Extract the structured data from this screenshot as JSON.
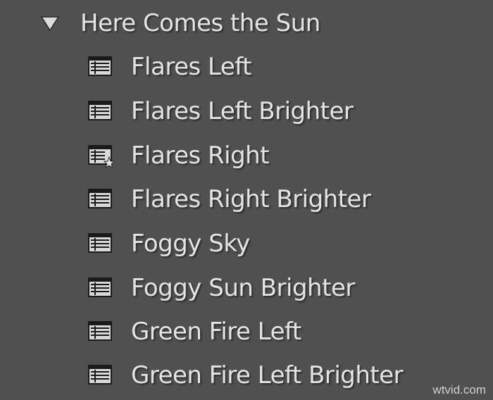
{
  "panel": {
    "group": {
      "title": "Here Comes the Sun",
      "expanded": true,
      "disclosure_icon": "triangle-down-icon"
    },
    "presets": [
      {
        "label": "Flares Left",
        "icon": "preset-icon",
        "favorite": false
      },
      {
        "label": "Flares Left Brighter",
        "icon": "preset-icon",
        "favorite": false
      },
      {
        "label": "Flares Right",
        "icon": "preset-favorite-icon",
        "favorite": true
      },
      {
        "label": "Flares Right Brighter",
        "icon": "preset-icon",
        "favorite": false
      },
      {
        "label": "Foggy Sky",
        "icon": "preset-icon",
        "favorite": false
      },
      {
        "label": "Foggy Sun Brighter",
        "icon": "preset-icon",
        "favorite": false
      },
      {
        "label": "Green Fire Left",
        "icon": "preset-icon",
        "favorite": false
      },
      {
        "label": "Green Fire Left Brighter",
        "icon": "preset-icon",
        "favorite": false
      }
    ]
  },
  "colors": {
    "background": "#505050",
    "text": "#e4e4e4",
    "icon_fill": "#d8d8d8",
    "icon_outline": "#1a1a1a"
  },
  "watermark": "wtvid.com"
}
